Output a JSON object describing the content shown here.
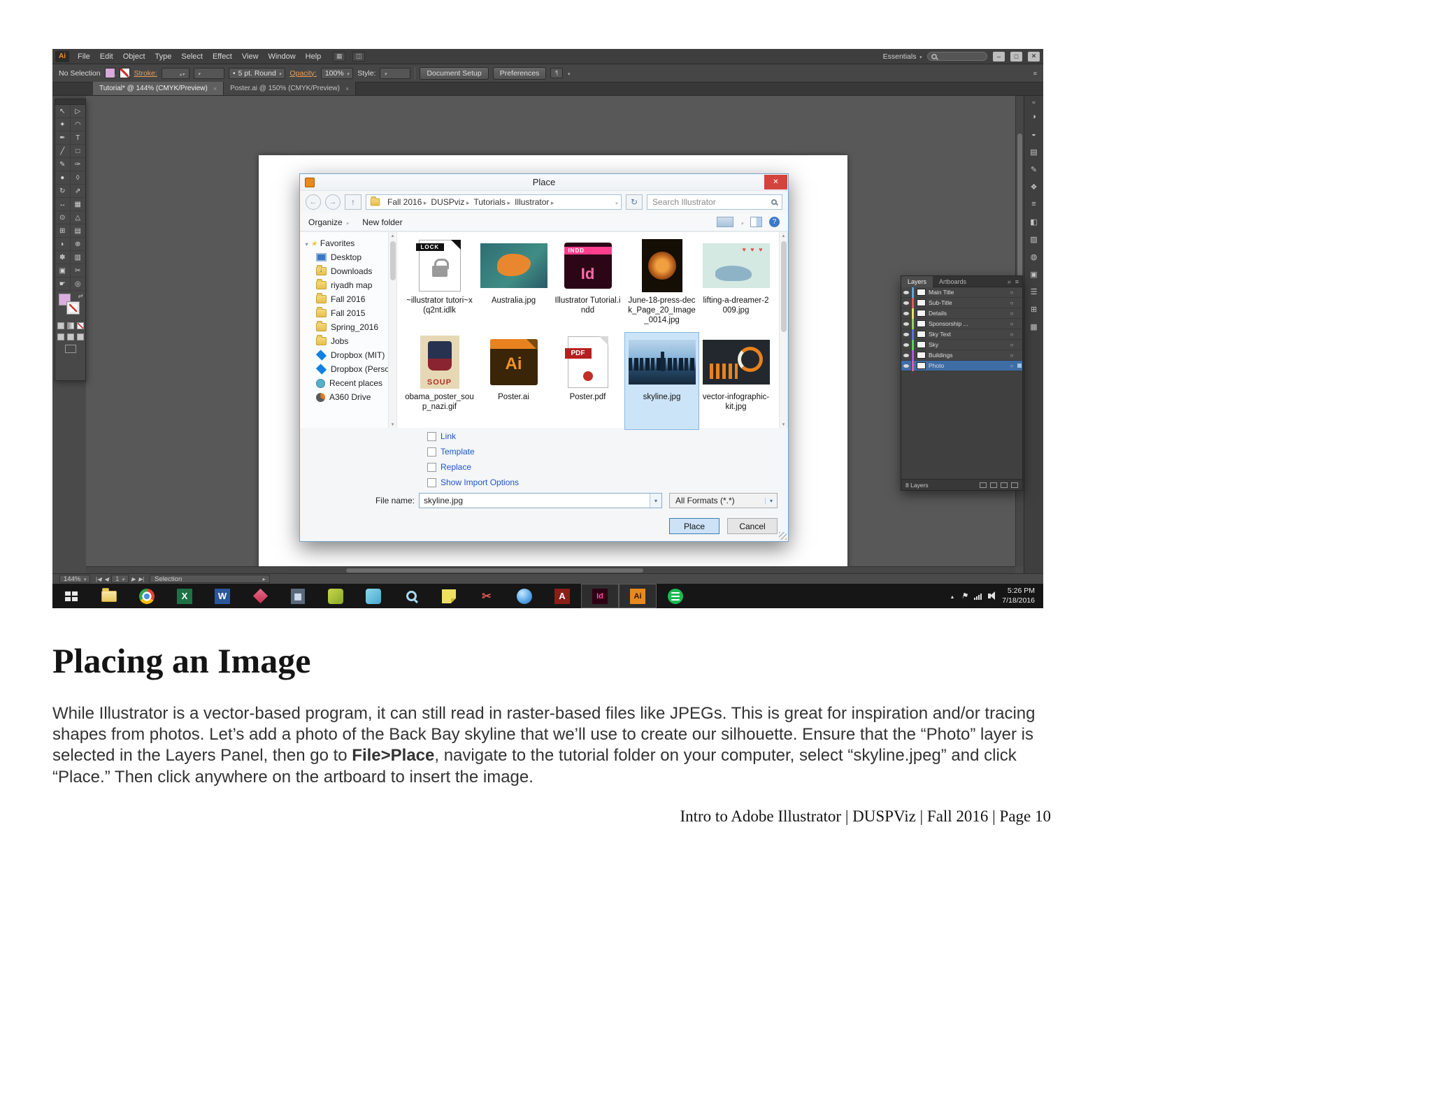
{
  "document": {
    "heading": "Placing an Image",
    "para_before": "While Illustrator is a vector-based program, it can still read in raster-based files like JPEGs. This is great for inspiration and/or tracing shapes from photos. Let’s add a photo of the Back Bay skyline that we’ll use to create our silhouette. Ensure that the “Photo” layer is selected in the Layers Panel, then go to ",
    "para_bold": "File>Place",
    "para_after": ", navigate to the tutorial folder on your computer, select “skyline.jpeg” and click “Place.” Then click anywhere on the artboard to insert the image.",
    "footer": "Intro to Adobe Illustrator | DUSPViz | Fall 2016 | Page 10"
  },
  "menubar": {
    "logo": "Ai",
    "menus": [
      "File",
      "Edit",
      "Object",
      "Type",
      "Select",
      "Effect",
      "View",
      "Window",
      "Help"
    ],
    "workspace": "Essentials",
    "window_buttons": [
      "–",
      "□",
      "✕"
    ]
  },
  "controlbar": {
    "selection": "No Selection",
    "stroke_label": "Stroke:",
    "brush": "5 pt. Round",
    "opacity_label": "Opacity:",
    "opacity_value": "100%",
    "style_label": "Style:",
    "document_setup": "Document Setup",
    "preferences": "Preferences"
  },
  "tabs": [
    {
      "label": "Tutorial* @ 144% (CMYK/Preview)",
      "close": "×"
    },
    {
      "label": "Poster.ai @ 150% (CMYK/Preview)",
      "close": "×"
    }
  ],
  "tools": [
    {
      "name": "selection-tool",
      "glyph": "↖"
    },
    {
      "name": "direct-selection-tool",
      "glyph": "▷"
    },
    {
      "name": "magic-wand-tool",
      "glyph": "✦"
    },
    {
      "name": "lasso-tool",
      "glyph": "◠"
    },
    {
      "name": "pen-tool",
      "glyph": "✒"
    },
    {
      "name": "type-tool",
      "glyph": "T"
    },
    {
      "name": "line-segment-tool",
      "glyph": "╱"
    },
    {
      "name": "rectangle-tool",
      "glyph": "□"
    },
    {
      "name": "paintbrush-tool",
      "glyph": "✎"
    },
    {
      "name": "pencil-tool",
      "glyph": "✑"
    },
    {
      "name": "blob-brush-tool",
      "glyph": "●"
    },
    {
      "name": "eraser-tool",
      "glyph": "◊"
    },
    {
      "name": "rotate-tool",
      "glyph": "↻"
    },
    {
      "name": "scale-tool",
      "glyph": "⇗"
    },
    {
      "name": "width-tool",
      "glyph": "↔"
    },
    {
      "name": "free-transform-tool",
      "glyph": "▦"
    },
    {
      "name": "shape-builder-tool",
      "glyph": "⊙"
    },
    {
      "name": "perspective-grid-tool",
      "glyph": "△"
    },
    {
      "name": "mesh-tool",
      "glyph": "⊞"
    },
    {
      "name": "gradient-tool",
      "glyph": "▤"
    },
    {
      "name": "eyedropper-tool",
      "glyph": "◗"
    },
    {
      "name": "blend-tool",
      "glyph": "⊕"
    },
    {
      "name": "symbol-sprayer-tool",
      "glyph": "✽"
    },
    {
      "name": "column-graph-tool",
      "glyph": "▥"
    },
    {
      "name": "artboard-tool",
      "glyph": "▣"
    },
    {
      "name": "slice-tool",
      "glyph": "✂"
    },
    {
      "name": "hand-tool",
      "glyph": "☛"
    },
    {
      "name": "zoom-tool",
      "glyph": "◎"
    }
  ],
  "statusbar": {
    "zoom": "144%",
    "artboard": "1",
    "tool": "Selection"
  },
  "dialog": {
    "title": "Place",
    "crumbs": [
      "Fall 2016",
      "DUSPviz",
      "Tutorials",
      "Illustrator"
    ],
    "search_placeholder": "Search Illustrator",
    "organize": "Organize",
    "new_folder": "New folder",
    "favorites": "Favorites",
    "places": [
      {
        "name": "Desktop",
        "icon": "desktop"
      },
      {
        "name": "Downloads",
        "icon": "downloads"
      },
      {
        "name": "riyadh map",
        "icon": "folder"
      },
      {
        "name": "Fall 2016",
        "icon": "folder"
      },
      {
        "name": "Fall 2015",
        "icon": "folder"
      },
      {
        "name": "Spring_2016",
        "icon": "folder"
      },
      {
        "name": "Jobs",
        "icon": "folder"
      },
      {
        "name": "Dropbox (MIT)",
        "icon": "dropbox"
      },
      {
        "name": "Dropbox (Persona",
        "icon": "dropbox"
      },
      {
        "name": "Recent places",
        "icon": "recent"
      },
      {
        "name": "A360 Drive",
        "icon": "drive"
      }
    ],
    "files": [
      {
        "name": "~illustrator tutori~x(q2nt.idlk",
        "kind": "thumb-lock",
        "t1": "LOCK",
        "t2": ""
      },
      {
        "name": "Australia.jpg",
        "kind": "thumb-australia",
        "t1": "",
        "t2": ""
      },
      {
        "name": "Illustrator Tutorial.indd",
        "kind": "thumb-indd",
        "t1": "INDD",
        "t2": "Id"
      },
      {
        "name": "June-18-press-deck_Page_20_Image_0014.jpg",
        "kind": "thumb-june",
        "t1": "",
        "t2": ""
      },
      {
        "name": "lifting-a-dreamer-2009.jpg",
        "kind": "thumb-whale",
        "t1": "",
        "t2": ""
      },
      {
        "name": "obama_poster_soup_nazi.gif",
        "kind": "thumb-soup",
        "t1": "",
        "t2": "SOUP"
      },
      {
        "name": "Poster.ai",
        "kind": "thumb-aifile",
        "t1": "",
        "t2": "Ai"
      },
      {
        "name": "Poster.pdf",
        "kind": "thumb-pdf",
        "t1": "PDF",
        "t2": ""
      },
      {
        "name": "skyline.jpg",
        "kind": "thumb-skyline",
        "t1": "",
        "t2": "",
        "state": "selected"
      },
      {
        "name": "vector-infographic-kit.jpg",
        "kind": "thumb-infographic",
        "t1": "",
        "t2": ""
      }
    ],
    "options": [
      {
        "label": "Link"
      },
      {
        "label": "Template"
      },
      {
        "label": "Replace"
      },
      {
        "label": "Show Import Options"
      }
    ],
    "filename_label": "File name:",
    "filename_value": "skyline.jpg",
    "format_value": "All Formats (*.*)",
    "place": "Place",
    "cancel": "Cancel"
  },
  "layers_panel": {
    "tab_layers": "Layers",
    "tab_artboards": "Artboards",
    "layers": [
      {
        "name": "Main Title",
        "color": "#58a7e8"
      },
      {
        "name": "Sub-Title",
        "color": "#e85858"
      },
      {
        "name": "Details",
        "color": "#e8e158"
      },
      {
        "name": "Sponsorship ...",
        "color": "#9ad158"
      },
      {
        "name": "Sky Text",
        "color": "#5872e8"
      },
      {
        "name": "Sky",
        "color": "#58d158"
      },
      {
        "name": "Buildings",
        "color": "#a858e8"
      },
      {
        "name": "Photo",
        "color": "#e858a7",
        "state": "selected"
      }
    ],
    "count": "8 Layers"
  },
  "dock_icons": [
    {
      "name": "expand-panels-icon",
      "glyph": "«"
    },
    {
      "name": "color-panel-icon",
      "glyph": "◑"
    },
    {
      "name": "color-guide-panel-icon",
      "glyph": "◒"
    },
    {
      "name": "swatches-panel-icon",
      "glyph": "▤"
    },
    {
      "name": "brushes-panel-icon",
      "glyph": "✎"
    },
    {
      "name": "symbols-panel-icon",
      "glyph": "❖"
    },
    {
      "name": "stroke-panel-icon",
      "glyph": "≡"
    },
    {
      "name": "gradient-panel-icon",
      "glyph": "◧"
    },
    {
      "name": "transparency-panel-icon",
      "glyph": "▨"
    },
    {
      "name": "appearance-panel-icon",
      "glyph": "◍"
    },
    {
      "name": "graphic-styles-panel-icon",
      "glyph": "▣"
    },
    {
      "name": "layers-panel-icon",
      "glyph": "☰"
    },
    {
      "name": "artboards-panel-icon",
      "glyph": "⊞"
    },
    {
      "name": "links-panel-icon",
      "glyph": "▦"
    }
  ],
  "taskbar": {
    "icons": [
      {
        "name": "start-button",
        "kind": "ic-start",
        "letter": ""
      },
      {
        "name": "file-explorer-icon",
        "kind": "ic-explorer",
        "letter": ""
      },
      {
        "name": "chrome-icon",
        "kind": "ic-chrome",
        "letter": ""
      },
      {
        "name": "excel-icon",
        "kind": "ic-excel",
        "letter": "X"
      },
      {
        "name": "word-icon",
        "kind": "ic-word",
        "letter": "W"
      },
      {
        "name": "office-diamond-icon",
        "kind": "ic-diamond",
        "letter": ""
      },
      {
        "name": "calculator-icon",
        "kind": "ic-calc",
        "letter": ""
      },
      {
        "name": "paint-app-icon",
        "kind": "ic-green",
        "letter": ""
      },
      {
        "name": "notes-app-icon",
        "kind": "ic-cyan",
        "letter": ""
      },
      {
        "name": "magnifier-icon",
        "kind": "ic-magnifier",
        "letter": ""
      },
      {
        "name": "sticky-notes-icon",
        "kind": "ic-sticky",
        "letter": ""
      },
      {
        "name": "snipping-tool-icon",
        "kind": "ic-snip",
        "letter": ""
      },
      {
        "name": "browser-icon",
        "kind": "ic-globe",
        "letter": ""
      },
      {
        "name": "autocad-icon",
        "kind": "ic-autocad",
        "letter": "A"
      },
      {
        "name": "indesign-icon",
        "kind": "ic-indesign",
        "letter": "Id",
        "state": "running"
      },
      {
        "name": "illustrator-icon",
        "kind": "ic-illustrator",
        "letter": "Ai",
        "state": "running"
      },
      {
        "name": "spotify-icon",
        "kind": "ic-spotify",
        "letter": ""
      }
    ],
    "time": "5:26 PM",
    "date": "7/18/2016"
  }
}
